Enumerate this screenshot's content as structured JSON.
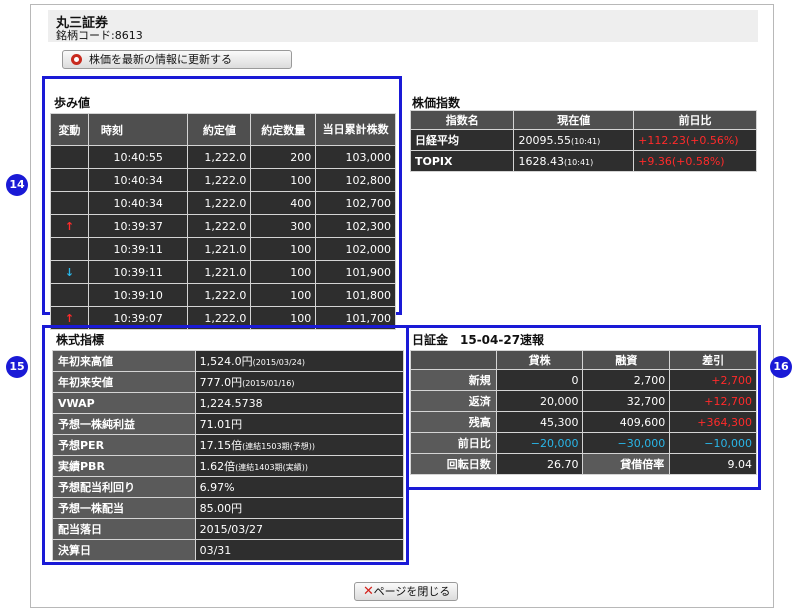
{
  "header": {
    "company": "丸三証券",
    "code_line": "銘柄コード:8613"
  },
  "update_button": {
    "label": "株価を最新の情報に更新する"
  },
  "badges": {
    "b14": "14",
    "b15": "15",
    "b16": "16"
  },
  "ayumi": {
    "title": "歩み値",
    "columns": [
      "変動",
      "時刻",
      "約定値",
      "約定数量",
      "当日累計株数"
    ],
    "rows": [
      {
        "change": "",
        "time": "10:40:55",
        "price": "1,222.0",
        "qty": "200",
        "cum": "103,000"
      },
      {
        "change": "",
        "time": "10:40:34",
        "price": "1,222.0",
        "qty": "100",
        "cum": "102,800"
      },
      {
        "change": "",
        "time": "10:40:34",
        "price": "1,222.0",
        "qty": "400",
        "cum": "102,700"
      },
      {
        "change": "↑",
        "time": "10:39:37",
        "price": "1,222.0",
        "qty": "300",
        "cum": "102,300"
      },
      {
        "change": "",
        "time": "10:39:11",
        "price": "1,221.0",
        "qty": "100",
        "cum": "102,000"
      },
      {
        "change": "↓",
        "time": "10:39:11",
        "price": "1,221.0",
        "qty": "100",
        "cum": "101,900"
      },
      {
        "change": "",
        "time": "10:39:10",
        "price": "1,222.0",
        "qty": "100",
        "cum": "101,800"
      },
      {
        "change": "↑",
        "time": "10:39:07",
        "price": "1,222.0",
        "qty": "100",
        "cum": "101,700"
      }
    ]
  },
  "index": {
    "title": "株価指数",
    "columns": [
      "指数名",
      "現在値",
      "前日比"
    ],
    "rows": [
      {
        "name": "日経平均",
        "value": "20095.55",
        "time": "(10:41)",
        "change": "+112.23(+0.56%)"
      },
      {
        "name": "TOPIX",
        "value": "1628.43",
        "time": "(10:41)",
        "change": "+9.36(+0.58%)"
      }
    ]
  },
  "indicators": {
    "title": "株式指標",
    "rows": [
      {
        "label": "年初来高値",
        "value": "1,524.0円",
        "note": "(2015/03/24)"
      },
      {
        "label": "年初来安値",
        "value": "777.0円",
        "note": "(2015/01/16)"
      },
      {
        "label": "VWAP",
        "value": "1,224.5738",
        "note": ""
      },
      {
        "label": "予想一株純利益",
        "value": "71.01円",
        "note": ""
      },
      {
        "label": "予想PER",
        "value": "17.15倍",
        "note": "(連結1503期(予想))"
      },
      {
        "label": "実績PBR",
        "value": "1.62倍",
        "note": "(連結1403期(実績))"
      },
      {
        "label": "予想配当利回り",
        "value": "6.97%",
        "note": ""
      },
      {
        "label": "予想一株配当",
        "value": "85.00円",
        "note": ""
      },
      {
        "label": "配当落日",
        "value": "2015/03/27",
        "note": ""
      },
      {
        "label": "決算日",
        "value": "03/31",
        "note": ""
      }
    ]
  },
  "margin": {
    "title": "日証金　15-04-27速報",
    "columns": [
      "貸株",
      "融資",
      "差引"
    ],
    "rows": [
      {
        "label": "新規",
        "lend": "0",
        "loan": "2,700",
        "diff": "+2,700"
      },
      {
        "label": "返済",
        "lend": "20,000",
        "loan": "32,700",
        "diff": "+12,700"
      },
      {
        "label": "残高",
        "lend": "45,300",
        "loan": "409,600",
        "diff": "+364,300"
      },
      {
        "label": "前日比",
        "lend": "−20,000",
        "loan": "−30,000",
        "diff": "−10,000"
      }
    ],
    "turnover_label": "回転日数",
    "turnover_value": "26.70",
    "ratio_label": "貸借倍率",
    "ratio_value": "9.04"
  },
  "close_button": {
    "label": "ページを閉じる"
  },
  "colors": {
    "accent_blue": "#1a1ad6",
    "up_red": "#ff2a2a",
    "down_cyan": "#29b6e8"
  }
}
